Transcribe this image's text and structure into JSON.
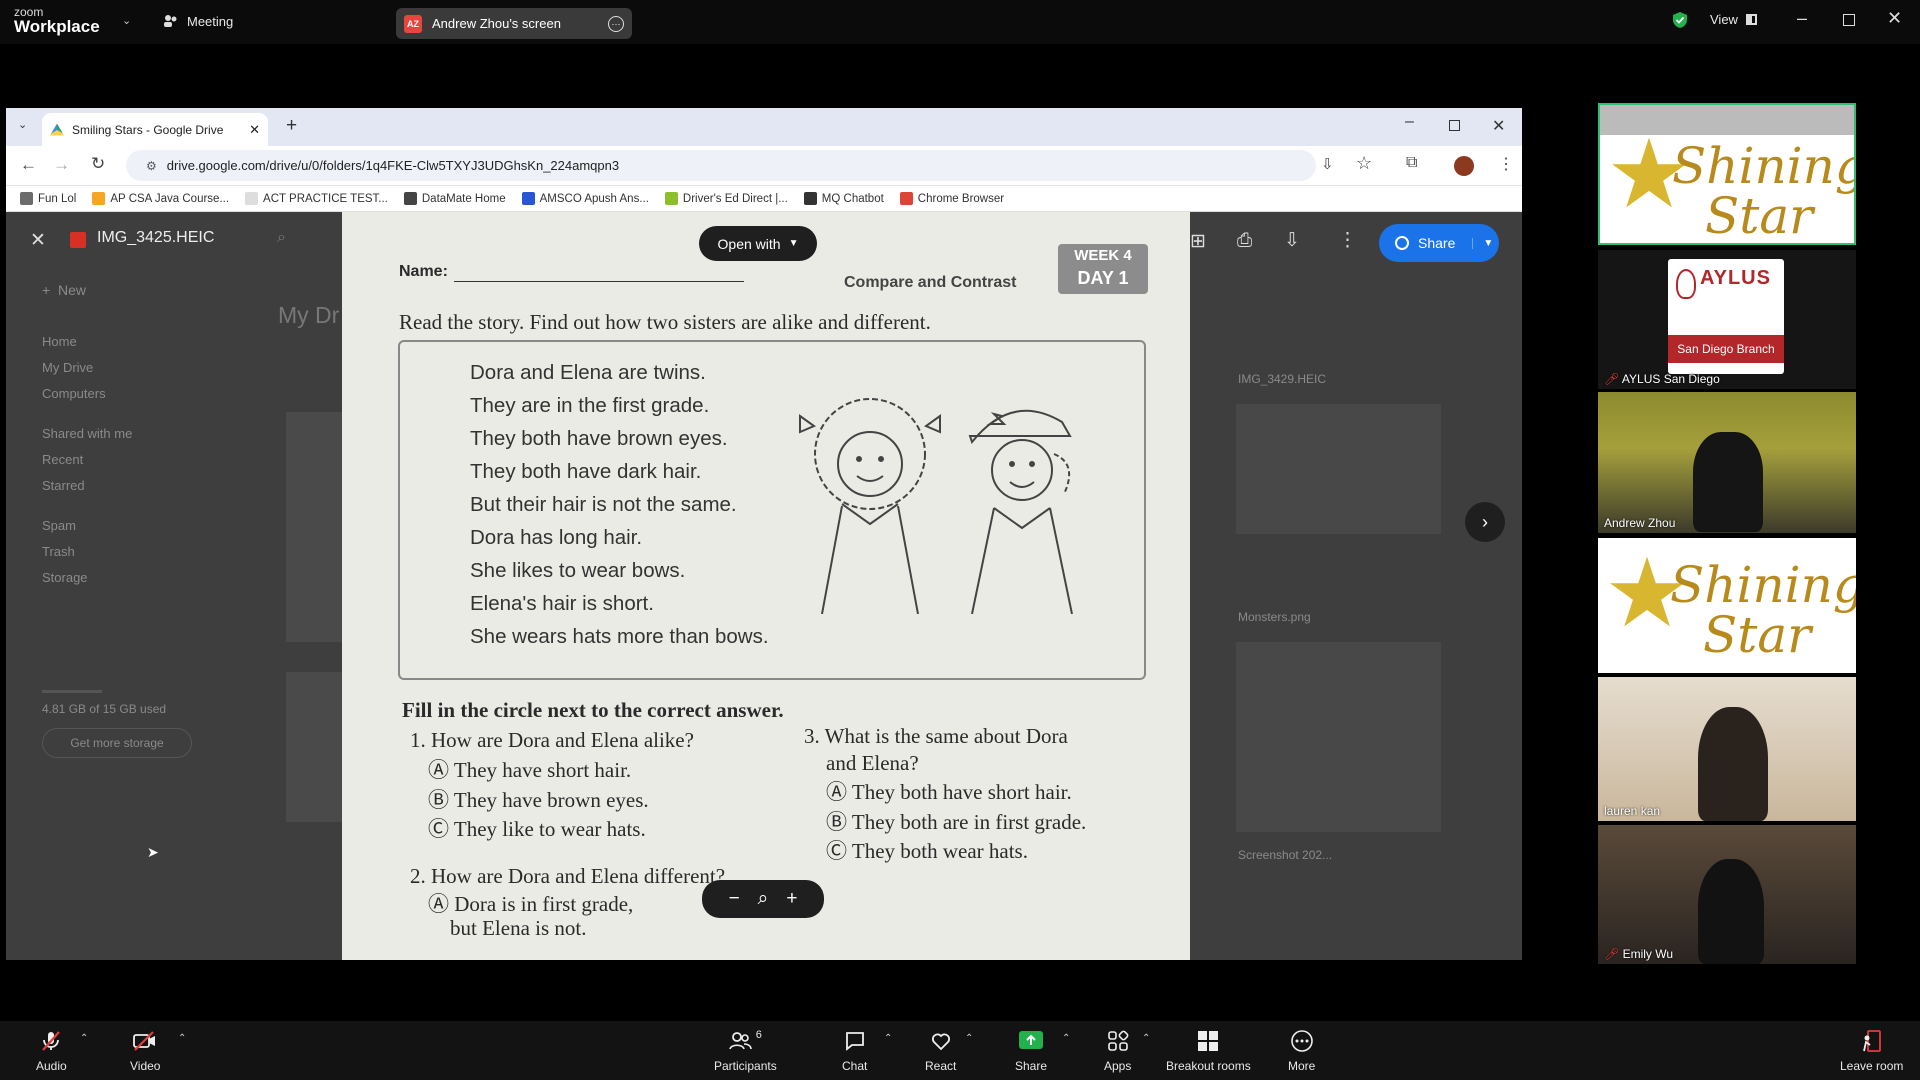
{
  "zoom": {
    "brand_top": "zoom",
    "brand_bottom": "Workplace",
    "meeting_label": "Meeting",
    "share_badge": "AZ",
    "share_title": "Andrew Zhou's screen",
    "view_label": "View",
    "bottom": {
      "audio": "Audio",
      "video": "Video",
      "participants": "Participants",
      "participants_count": "6",
      "chat": "Chat",
      "react": "React",
      "share": "Share",
      "apps": "Apps",
      "breakout": "Breakout rooms",
      "more": "More",
      "leave": "Leave room"
    }
  },
  "browser": {
    "tab_title": "Smiling Stars - Google Drive",
    "url": "drive.google.com/drive/u/0/folders/1q4FKE-Clw5TXYJ3UDGhsKn_224amqpn3",
    "bookmarks": [
      {
        "label": "Fun Lol",
        "color": "#6b6b6b"
      },
      {
        "label": "AP CSA Java Course...",
        "color": "#f5a623"
      },
      {
        "label": "ACT PRACTICE TEST...",
        "color": "#dddddd"
      },
      {
        "label": "DataMate Home",
        "color": "#444444"
      },
      {
        "label": "AMSCO Apush Ans...",
        "color": "#2a55d3"
      },
      {
        "label": "Driver's Ed Direct |...",
        "color": "#8cbf2b"
      },
      {
        "label": "MQ Chatbot",
        "color": "#333333"
      },
      {
        "label": "Chrome Browser",
        "color": "#db4437"
      }
    ]
  },
  "drive": {
    "file_name": "IMG_3425.HEIC",
    "open_with": "Open with",
    "share": "Share",
    "bg_title": "My Dr",
    "new": "New",
    "nav": [
      "Home",
      "My Drive",
      "Computers",
      "Shared with me",
      "Recent",
      "Starred",
      "Spam",
      "Trash",
      "Storage"
    ],
    "storage_text": "4.81 GB of 15 GB used",
    "get_storage": "Get more storage",
    "bg_files": [
      "IMG_3429.HEIC",
      "Monsters.png",
      "Screenshot 202..."
    ]
  },
  "worksheet": {
    "week": "WEEK 4",
    "day": "DAY 1",
    "name_label": "Name:",
    "topic": "Compare and Contrast",
    "instruction": "Read the story. Find out how two sisters are alike and different.",
    "story": [
      "Dora and Elena are twins.",
      "They are in the first grade.",
      "They both have brown eyes.",
      "They both have dark hair.",
      "But their hair is not the same.",
      "Dora has long hair.",
      "She likes to wear bows.",
      "Elena's hair is short.",
      "She wears hats more than bows."
    ],
    "fill_instruction": "Fill in the circle next to the correct answer.",
    "q1": "1. How are Dora and Elena alike?",
    "q1_opts": [
      "Ⓐ They have short hair.",
      "Ⓑ They have brown eyes.",
      "Ⓒ They like to wear hats."
    ],
    "q2": "2. How are Dora and Elena different?",
    "q2_opt": "Ⓐ Dora is in first grade,",
    "q2_cont": "but Elena is not.",
    "q3a": "3. What is the same about Dora",
    "q3b": "and Elena?",
    "q3_opts": [
      "Ⓐ They both have short hair.",
      "Ⓑ They both are in first grade.",
      "Ⓒ They both wear hats."
    ]
  },
  "participants": [
    {
      "name": "",
      "kind": "star"
    },
    {
      "name": "AYLUS San Diego",
      "kind": "aylus",
      "muted": true,
      "logo_title": "AYLUS",
      "logo_sub": "San Diego Branch"
    },
    {
      "name": "Andrew Zhou",
      "kind": "video"
    },
    {
      "name": "",
      "kind": "star"
    },
    {
      "name": "lauren kan",
      "kind": "video"
    },
    {
      "name": "Emily Wu",
      "kind": "video",
      "muted": true
    }
  ],
  "star_logo": {
    "line1": "Shining",
    "line2": "Star"
  }
}
